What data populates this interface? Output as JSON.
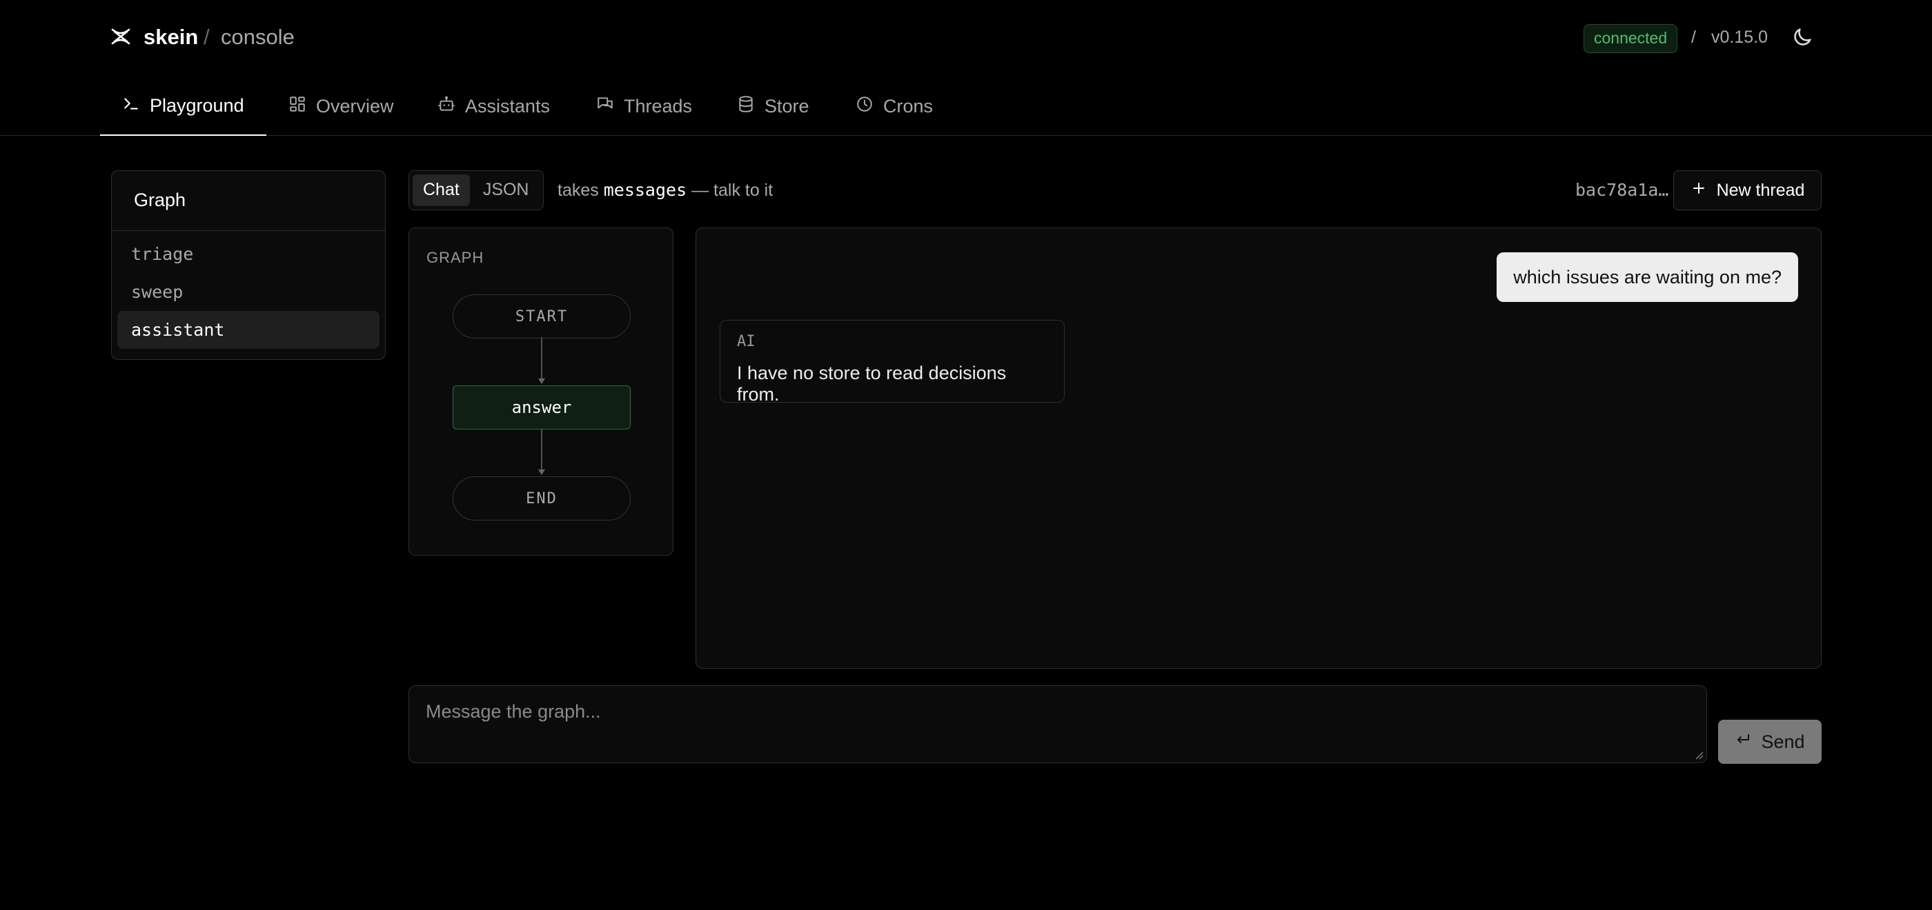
{
  "header": {
    "logo_icon": "skein-logo-icon",
    "brand": "skein",
    "separator": "/",
    "subtitle": "console",
    "status": "connected",
    "status_color": "#4cc06a",
    "version_separator": "/",
    "version": "v0.15.0",
    "theme_icon": "moon-icon"
  },
  "nav": {
    "tabs": [
      {
        "label": "Playground",
        "icon": "terminal-icon",
        "active": true
      },
      {
        "label": "Overview",
        "icon": "grid-icon",
        "active": false
      },
      {
        "label": "Assistants",
        "icon": "robot-icon",
        "active": false
      },
      {
        "label": "Threads",
        "icon": "chat-bubbles-icon",
        "active": false
      },
      {
        "label": "Store",
        "icon": "database-icon",
        "active": false
      },
      {
        "label": "Crons",
        "icon": "clock-icon",
        "active": false
      }
    ]
  },
  "sidebar": {
    "title": "Graph",
    "items": [
      {
        "label": "triage",
        "active": false
      },
      {
        "label": "sweep",
        "active": false
      },
      {
        "label": "assistant",
        "active": true
      }
    ]
  },
  "toolbar": {
    "modes": [
      {
        "label": "Chat",
        "active": true
      },
      {
        "label": "JSON",
        "active": false
      }
    ],
    "hint_prefix": "takes",
    "hint_code": "messages",
    "hint_suffix": "— talk to it",
    "thread_id": "bac78a1a…",
    "new_thread_label": "New thread"
  },
  "graph": {
    "label": "GRAPH",
    "nodes": [
      "START",
      "answer",
      "END"
    ]
  },
  "chat": {
    "messages": [
      {
        "role": "user",
        "text": "which issues are waiting on me?"
      },
      {
        "role": "ai",
        "label": "AI",
        "text": "I have no store to read decisions from."
      }
    ]
  },
  "composer": {
    "placeholder": "Message the graph...",
    "send_label": "Send",
    "send_icon": "enter-icon"
  }
}
